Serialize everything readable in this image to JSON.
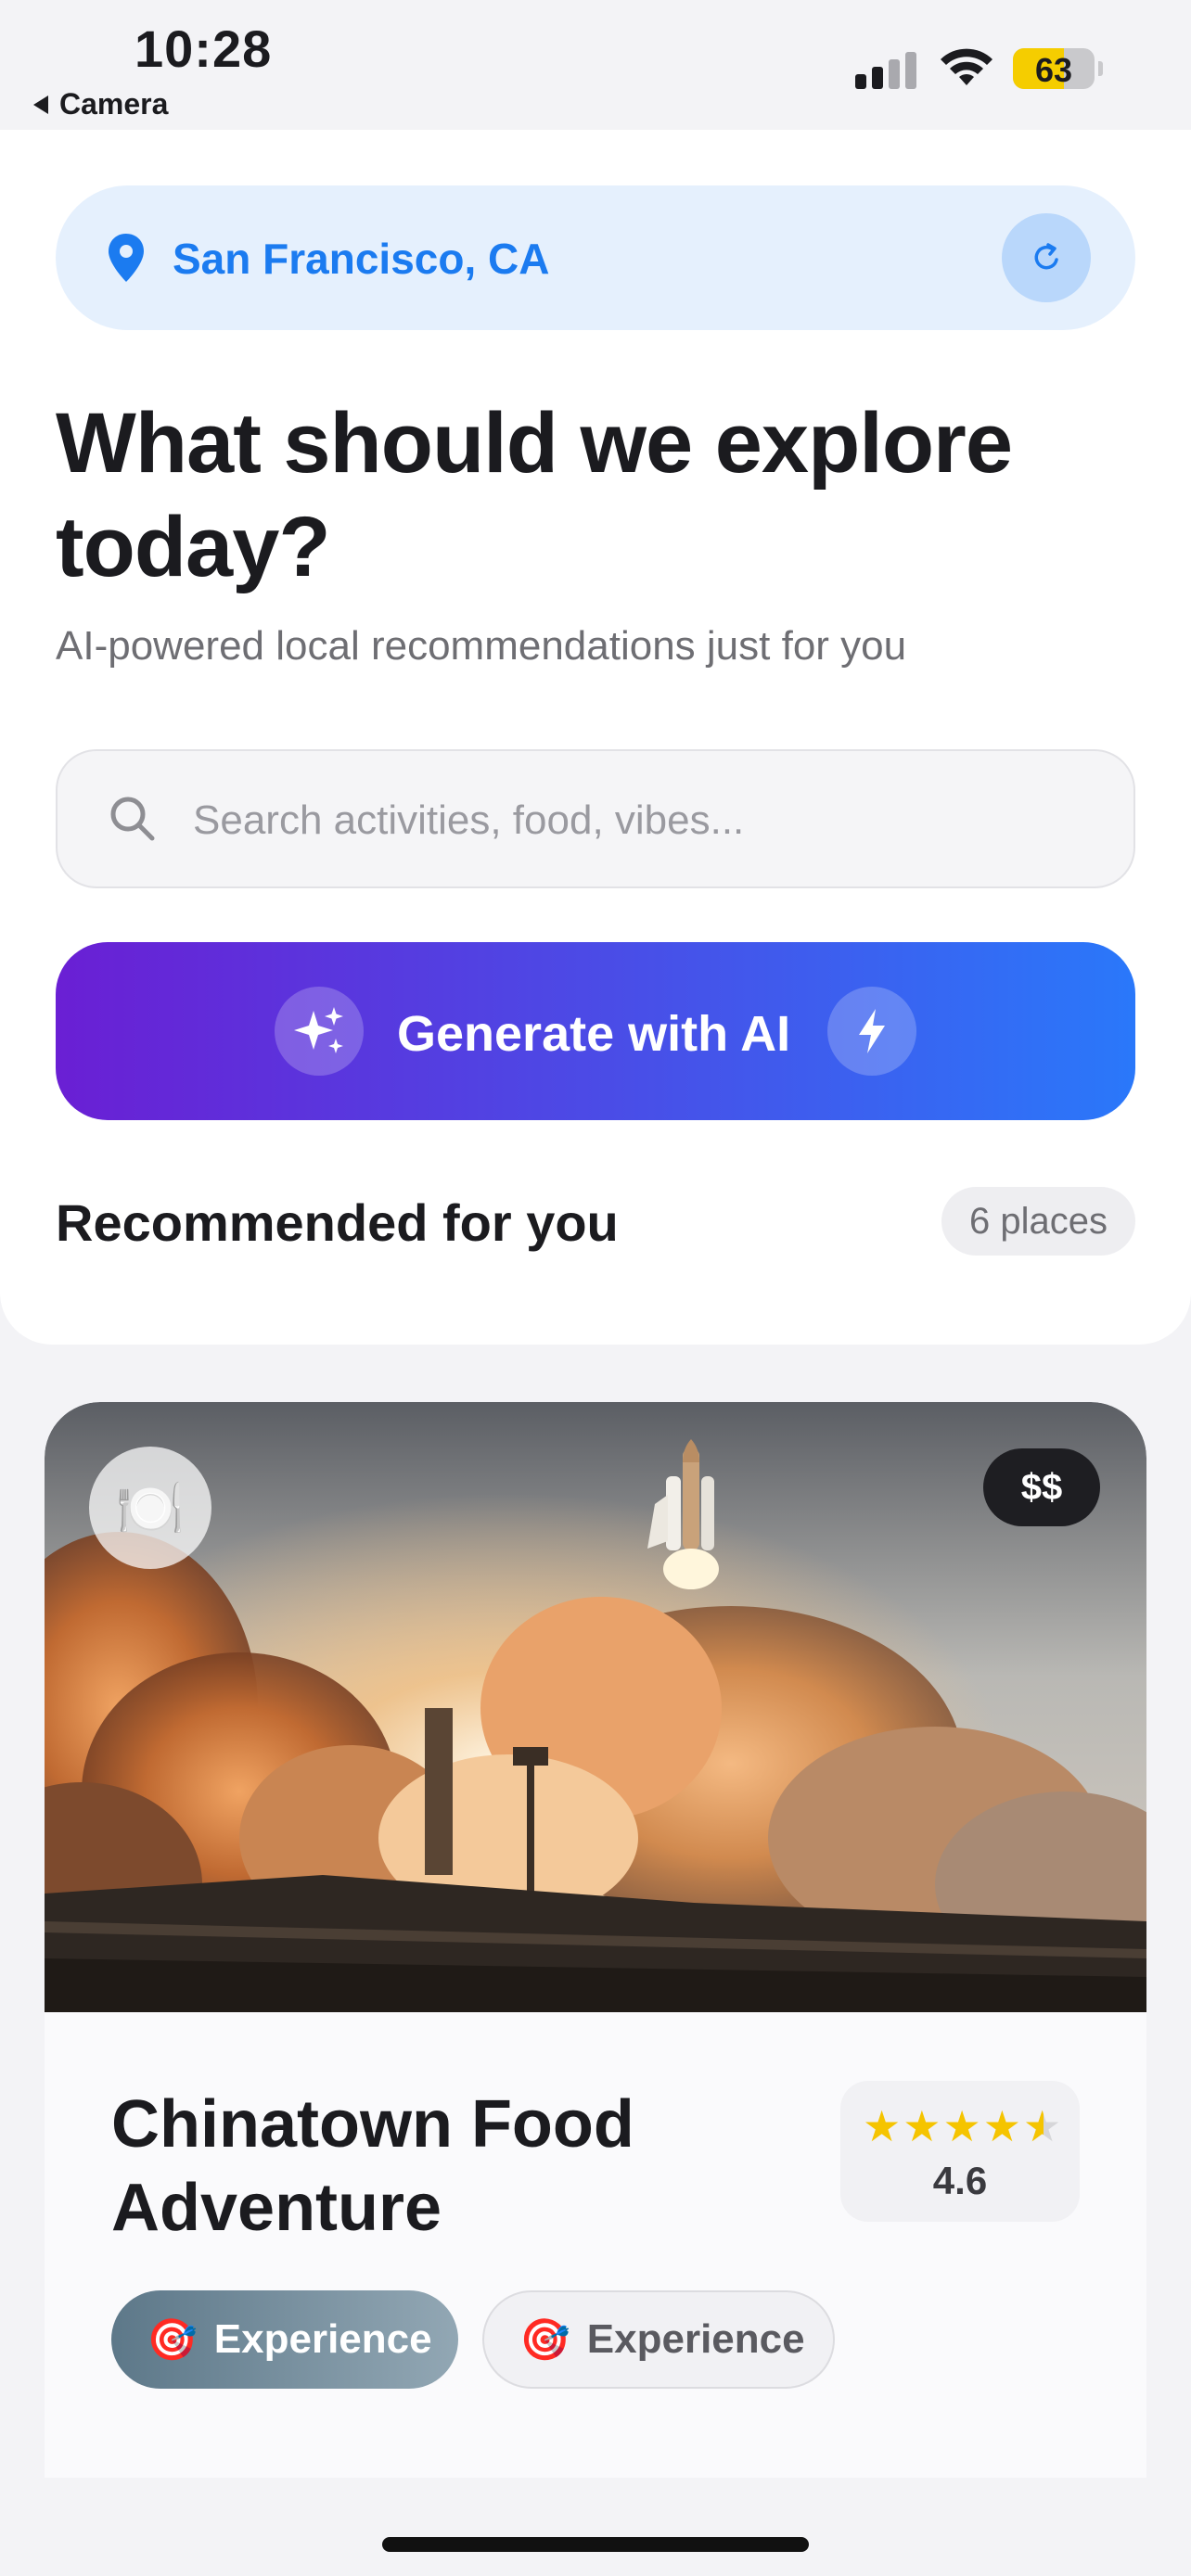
{
  "status_bar": {
    "time": "10:28",
    "back_label": "Camera",
    "battery_level": "63"
  },
  "location": {
    "label": "San Francisco, CA"
  },
  "headline": "What should we explore today?",
  "subtitle": "AI-powered local recommendations just for you",
  "search": {
    "placeholder": "Search activities, food, vibes..."
  },
  "generate_button": {
    "label": "Generate with AI"
  },
  "recommended": {
    "title": "Recommended for you",
    "count": "6 places"
  },
  "place": {
    "category_icon": "plate-cutlery-icon",
    "price": "$$",
    "name": "Chinatown Food Adventure",
    "rating_value": "4.6",
    "rating": 4.6,
    "tags": [
      {
        "emoji": "🎯",
        "label": "Experience"
      },
      {
        "emoji": "🎯",
        "label": "Experience"
      }
    ]
  },
  "colors": {
    "accent_blue": "#1b7bf0",
    "gradient_start": "#6a1fd4",
    "gradient_end": "#2a78fa",
    "star": "#f5c400"
  }
}
